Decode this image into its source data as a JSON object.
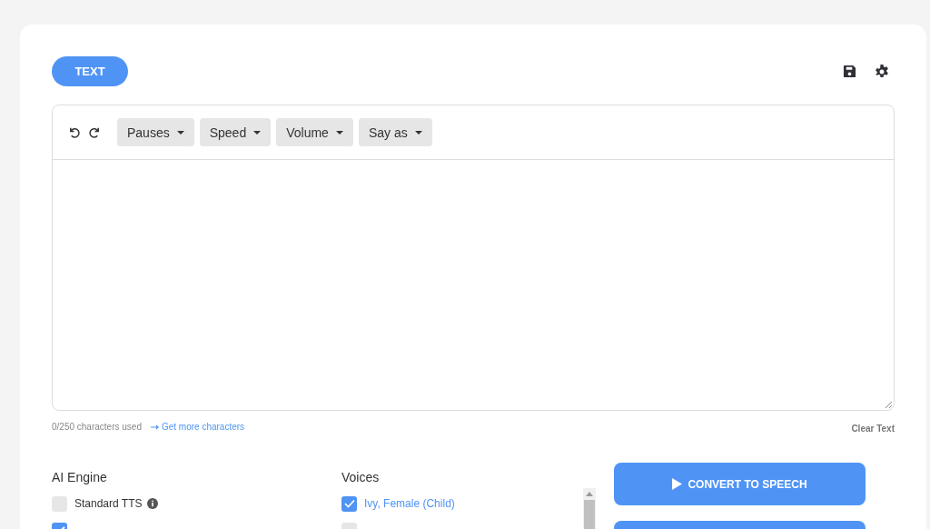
{
  "mode_button": {
    "label": "TEXT",
    "selected": true
  },
  "toolbar": {
    "dropdowns": [
      "Pauses",
      "Speed",
      "Volume",
      "Say as"
    ]
  },
  "editor": {
    "counter": "0/250 characters used",
    "more_link": "Get more characters",
    "clear": "Clear Text"
  },
  "engine": {
    "title": "AI Engine",
    "options": [
      {
        "label": "Standard TTS",
        "checked": false
      },
      {
        "checked": true
      }
    ]
  },
  "voices": {
    "title": "Voices",
    "items": [
      {
        "label": "Ivy, Female (Child)",
        "checked": true
      },
      {
        "checked": false
      }
    ]
  },
  "convert_button": "CONVERT TO SPEECH"
}
